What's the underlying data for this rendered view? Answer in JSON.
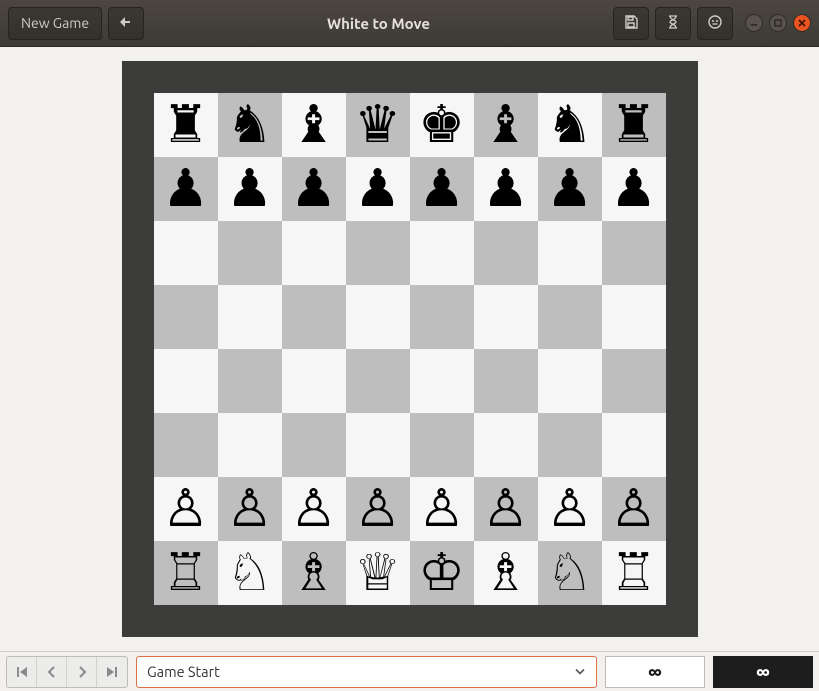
{
  "header": {
    "new_game_label": "New Game",
    "title": "White to Move"
  },
  "move_selector": {
    "current": "Game Start"
  },
  "clocks": {
    "white": "∞",
    "black": "∞"
  },
  "board": {
    "light_color": "#f6f6f6",
    "dark_color": "#bebebe",
    "frame_color": "#3c3c3b",
    "rows": [
      [
        "br",
        "bn",
        "bb",
        "bq",
        "bk",
        "bb",
        "bn",
        "br"
      ],
      [
        "bp",
        "bp",
        "bp",
        "bp",
        "bp",
        "bp",
        "bp",
        "bp"
      ],
      [
        "",
        "",
        "",
        "",
        "",
        "",
        "",
        ""
      ],
      [
        "",
        "",
        "",
        "",
        "",
        "",
        "",
        ""
      ],
      [
        "",
        "",
        "",
        "",
        "",
        "",
        "",
        ""
      ],
      [
        "",
        "",
        "",
        "",
        "",
        "",
        "",
        ""
      ],
      [
        "wp",
        "wp",
        "wp",
        "wp",
        "wp",
        "wp",
        "wp",
        "wp"
      ],
      [
        "wr",
        "wn",
        "wb",
        "wq",
        "wk",
        "wb",
        "wn",
        "wr"
      ]
    ]
  },
  "piece_glyphs": {
    "wk": "♔",
    "wq": "♕",
    "wr": "♖",
    "wb": "♗",
    "wn": "♘",
    "wp": "♙",
    "bk": "♚",
    "bq": "♛",
    "br": "♜",
    "bb": "♝",
    "bn": "♞",
    "bp": "♟"
  }
}
